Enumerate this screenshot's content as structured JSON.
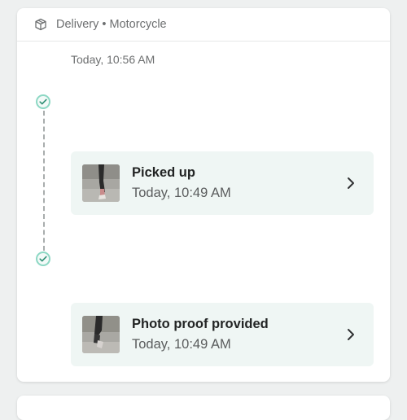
{
  "header": {
    "title": "Delivery • Motorcycle",
    "icon": "package-icon"
  },
  "timeline": {
    "top_timestamp": "Today, 10:56 AM",
    "events": [
      {
        "title": "Picked up",
        "time": "Today, 10:49 AM",
        "status": "completed"
      },
      {
        "title": "Photo proof provided",
        "time": "Today, 10:49 AM",
        "status": "completed"
      }
    ]
  },
  "colors": {
    "accent": "#3fae8e",
    "dot_border": "#8dd8c4",
    "event_bg": "#eff6f4",
    "page_bg": "#eef0f0"
  }
}
